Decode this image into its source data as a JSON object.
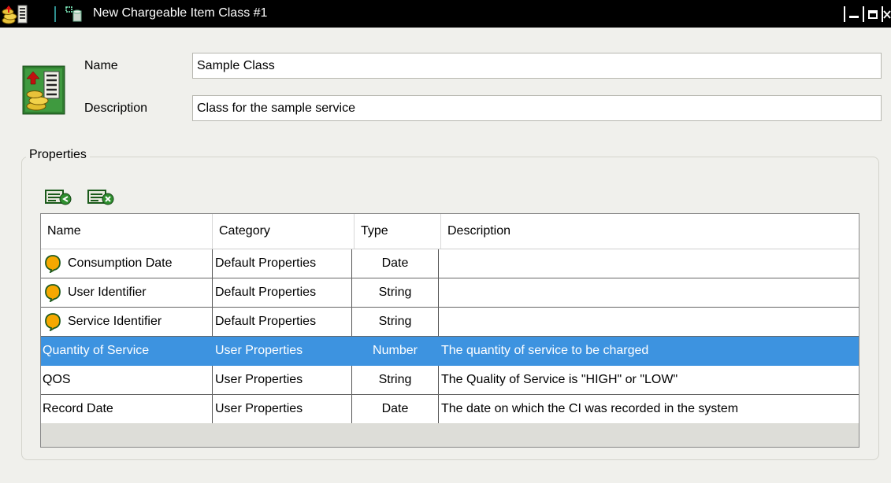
{
  "window": {
    "title": "New Chargeable Item Class #1",
    "controls": [
      "minimize-icon",
      "restore-icon",
      "close-icon"
    ]
  },
  "form": {
    "name_label": "Name",
    "name_value": "Sample Class",
    "description_label": "Description",
    "description_value": "Class for the sample service"
  },
  "properties": {
    "group_label": "Properties",
    "toolbar": [
      "add-property-icon",
      "remove-property-icon"
    ],
    "columns": [
      "Name",
      "Category",
      "Type",
      "Description"
    ],
    "rows": [
      {
        "name": "Consumption Date",
        "category": "Default Properties",
        "type": "Date",
        "description": "",
        "icon": "default-property-icon",
        "selected": false
      },
      {
        "name": "User Identifier",
        "category": "Default Properties",
        "type": "String",
        "description": "",
        "icon": "default-property-icon",
        "selected": false
      },
      {
        "name": "Service Identifier",
        "category": "Default Properties",
        "type": "String",
        "description": "",
        "icon": "default-property-icon",
        "selected": false
      },
      {
        "name": "Quantity of Service",
        "category": "User Properties",
        "type": "Number",
        "description": "The quantity of service to be charged",
        "icon": "",
        "selected": true
      },
      {
        "name": "QOS",
        "category": "User Properties",
        "type": "String",
        "description": "The Quality of Service is \"HIGH\" or \"LOW\"",
        "icon": "",
        "selected": false
      },
      {
        "name": "Record Date",
        "category": "User Properties",
        "type": "Date",
        "description": "The date on which the CI was recorded in the system",
        "icon": "",
        "selected": false
      }
    ]
  },
  "colors": {
    "titlebar_bg": "#000000",
    "window_bg": "#f0f0ec",
    "selection": "#3d93e0",
    "bullet": "#f5a800"
  }
}
